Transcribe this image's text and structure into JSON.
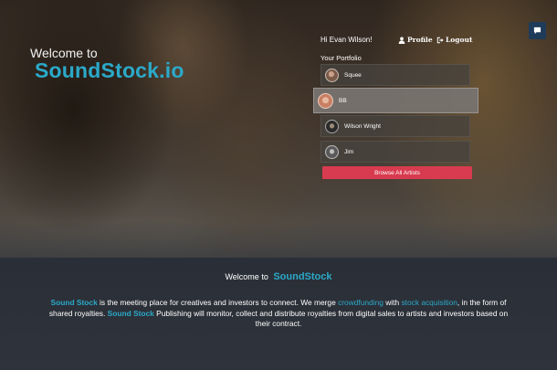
{
  "hero": {
    "welcome": "Welcome to",
    "brand": "SoundStock.io"
  },
  "user": {
    "greeting": "Hi Evan Wilson!",
    "profile_label": "Profile",
    "logout_label": "Logout"
  },
  "portfolio": {
    "label": "Your Portfolio",
    "items": [
      {
        "name": "Squee",
        "avatar_color": "#7a5a48"
      },
      {
        "name": "BB",
        "avatar_color": "#c87f63",
        "active": true
      },
      {
        "name": "Wilson Wright",
        "avatar_color": "#2a2a2a"
      },
      {
        "name": "Jim",
        "avatar_color": "#5a5a5a"
      }
    ],
    "browse_label": "Browse All Artists"
  },
  "about": {
    "title_prefix": "Welcome to",
    "title_brand": "SoundStock",
    "brand_name": "Sound Stock",
    "text_1": " is the meeting place for creatives and investors to connect. We merge ",
    "link_crowdfunding": "crowdfunding",
    "text_2": " with ",
    "link_stock": "stock acquisition",
    "text_3": ", in the form of shared royalties. ",
    "brand_name_2": "Sound Stock",
    "text_4": " Publishing will monitor, collect and distribute royalties from digital sales to artists and investors based on their contract."
  },
  "colors": {
    "accent": "#2ba9c9",
    "button_red": "#d83b4f",
    "chat_bg": "#1f3b5a"
  },
  "icons": {
    "profile": "user-icon",
    "logout": "sign-out-icon",
    "chat": "chat-bubble-icon"
  }
}
